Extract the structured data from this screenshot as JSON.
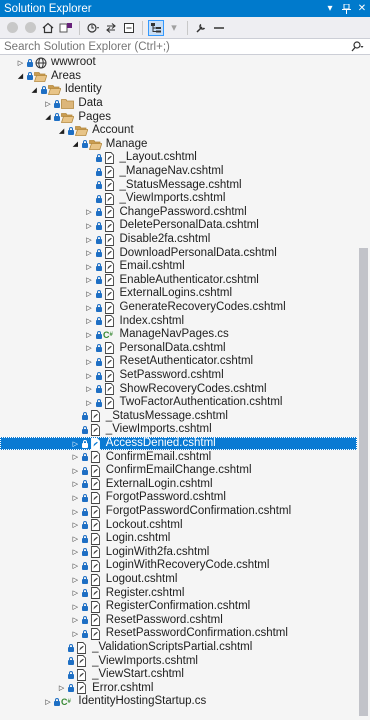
{
  "window": {
    "title": "Solution Explorer",
    "buttons": {
      "dropdown": "▾",
      "pin": "ᵖ",
      "close": "✕"
    }
  },
  "toolbar": {
    "items": [
      "back-icon",
      "forward-icon",
      "home-icon",
      "switch-views-icon",
      "pending-changes-filter-icon",
      "sync-icon",
      "collapse-all-icon",
      "show-all-files-icon",
      "properties-icon",
      "preview-icon"
    ]
  },
  "search": {
    "placeholder": "Search Solution Explorer (Ctrl+;)",
    "value": ""
  },
  "tree": {
    "rows": [
      {
        "label": "wwwroot",
        "depth": 0,
        "expander": "collapsed",
        "icon": "globe-icon"
      },
      {
        "label": "Areas",
        "depth": 0,
        "expander": "expanded",
        "icon": "folder-open-icon"
      },
      {
        "label": "Identity",
        "depth": 1,
        "expander": "expanded",
        "icon": "folder-open-icon"
      },
      {
        "label": "Data",
        "depth": 2,
        "expander": "collapsed",
        "icon": "folder-icon"
      },
      {
        "label": "Pages",
        "depth": 2,
        "expander": "expanded",
        "icon": "folder-open-icon"
      },
      {
        "label": "Account",
        "depth": 3,
        "expander": "expanded",
        "icon": "folder-open-icon"
      },
      {
        "label": "Manage",
        "depth": 4,
        "expander": "expanded",
        "icon": "folder-open-icon"
      },
      {
        "label": "_Layout.cshtml",
        "depth": 5,
        "expander": "none",
        "icon": "cshtml-file-icon"
      },
      {
        "label": "_ManageNav.cshtml",
        "depth": 5,
        "expander": "none",
        "icon": "cshtml-file-icon"
      },
      {
        "label": "_StatusMessage.cshtml",
        "depth": 5,
        "expander": "none",
        "icon": "cshtml-file-icon"
      },
      {
        "label": "_ViewImports.cshtml",
        "depth": 5,
        "expander": "none",
        "icon": "cshtml-file-icon"
      },
      {
        "label": "ChangePassword.cshtml",
        "depth": 5,
        "expander": "collapsed",
        "icon": "cshtml-file-icon"
      },
      {
        "label": "DeletePersonalData.cshtml",
        "depth": 5,
        "expander": "collapsed",
        "icon": "cshtml-file-icon"
      },
      {
        "label": "Disable2fa.cshtml",
        "depth": 5,
        "expander": "collapsed",
        "icon": "cshtml-file-icon"
      },
      {
        "label": "DownloadPersonalData.cshtml",
        "depth": 5,
        "expander": "collapsed",
        "icon": "cshtml-file-icon"
      },
      {
        "label": "Email.cshtml",
        "depth": 5,
        "expander": "collapsed",
        "icon": "cshtml-file-icon"
      },
      {
        "label": "EnableAuthenticator.cshtml",
        "depth": 5,
        "expander": "collapsed",
        "icon": "cshtml-file-icon"
      },
      {
        "label": "ExternalLogins.cshtml",
        "depth": 5,
        "expander": "collapsed",
        "icon": "cshtml-file-icon"
      },
      {
        "label": "GenerateRecoveryCodes.cshtml",
        "depth": 5,
        "expander": "collapsed",
        "icon": "cshtml-file-icon"
      },
      {
        "label": "Index.cshtml",
        "depth": 5,
        "expander": "collapsed",
        "icon": "cshtml-file-icon"
      },
      {
        "label": "ManageNavPages.cs",
        "depth": 5,
        "expander": "collapsed",
        "icon": "csharp-file-icon"
      },
      {
        "label": "PersonalData.cshtml",
        "depth": 5,
        "expander": "collapsed",
        "icon": "cshtml-file-icon"
      },
      {
        "label": "ResetAuthenticator.cshtml",
        "depth": 5,
        "expander": "collapsed",
        "icon": "cshtml-file-icon"
      },
      {
        "label": "SetPassword.cshtml",
        "depth": 5,
        "expander": "collapsed",
        "icon": "cshtml-file-icon"
      },
      {
        "label": "ShowRecoveryCodes.cshtml",
        "depth": 5,
        "expander": "collapsed",
        "icon": "cshtml-file-icon"
      },
      {
        "label": "TwoFactorAuthentication.cshtml",
        "depth": 5,
        "expander": "collapsed",
        "icon": "cshtml-file-icon"
      },
      {
        "label": "_StatusMessage.cshtml",
        "depth": 4,
        "expander": "none",
        "icon": "cshtml-file-icon"
      },
      {
        "label": "_ViewImports.cshtml",
        "depth": 4,
        "expander": "none",
        "icon": "cshtml-file-icon"
      },
      {
        "label": "AccessDenied.cshtml",
        "depth": 4,
        "expander": "collapsed",
        "icon": "cshtml-file-icon",
        "selected": true
      },
      {
        "label": "ConfirmEmail.cshtml",
        "depth": 4,
        "expander": "collapsed",
        "icon": "cshtml-file-icon"
      },
      {
        "label": "ConfirmEmailChange.cshtml",
        "depth": 4,
        "expander": "collapsed",
        "icon": "cshtml-file-icon"
      },
      {
        "label": "ExternalLogin.cshtml",
        "depth": 4,
        "expander": "collapsed",
        "icon": "cshtml-file-icon"
      },
      {
        "label": "ForgotPassword.cshtml",
        "depth": 4,
        "expander": "collapsed",
        "icon": "cshtml-file-icon"
      },
      {
        "label": "ForgotPasswordConfirmation.cshtml",
        "depth": 4,
        "expander": "collapsed",
        "icon": "cshtml-file-icon"
      },
      {
        "label": "Lockout.cshtml",
        "depth": 4,
        "expander": "collapsed",
        "icon": "cshtml-file-icon"
      },
      {
        "label": "Login.cshtml",
        "depth": 4,
        "expander": "collapsed",
        "icon": "cshtml-file-icon"
      },
      {
        "label": "LoginWith2fa.cshtml",
        "depth": 4,
        "expander": "collapsed",
        "icon": "cshtml-file-icon"
      },
      {
        "label": "LoginWithRecoveryCode.cshtml",
        "depth": 4,
        "expander": "collapsed",
        "icon": "cshtml-file-icon"
      },
      {
        "label": "Logout.cshtml",
        "depth": 4,
        "expander": "collapsed",
        "icon": "cshtml-file-icon"
      },
      {
        "label": "Register.cshtml",
        "depth": 4,
        "expander": "collapsed",
        "icon": "cshtml-file-icon"
      },
      {
        "label": "RegisterConfirmation.cshtml",
        "depth": 4,
        "expander": "collapsed",
        "icon": "cshtml-file-icon"
      },
      {
        "label": "ResetPassword.cshtml",
        "depth": 4,
        "expander": "collapsed",
        "icon": "cshtml-file-icon"
      },
      {
        "label": "ResetPasswordConfirmation.cshtml",
        "depth": 4,
        "expander": "collapsed",
        "icon": "cshtml-file-icon"
      },
      {
        "label": "_ValidationScriptsPartial.cshtml",
        "depth": 3,
        "expander": "none",
        "icon": "cshtml-file-icon"
      },
      {
        "label": "_ViewImports.cshtml",
        "depth": 3,
        "expander": "none",
        "icon": "cshtml-file-icon"
      },
      {
        "label": "_ViewStart.cshtml",
        "depth": 3,
        "expander": "none",
        "icon": "cshtml-file-icon"
      },
      {
        "label": "Error.cshtml",
        "depth": 3,
        "expander": "collapsed",
        "icon": "cshtml-file-icon"
      },
      {
        "label": "IdentityHostingStartup.cs",
        "depth": 2,
        "expander": "collapsed",
        "icon": "csharp-file-icon"
      }
    ]
  },
  "colors": {
    "accent": "#007acc",
    "selection": "#0a7ad3",
    "folder": "#dcb67a",
    "lock": "#1e6fc4",
    "csharp": "#368832"
  }
}
